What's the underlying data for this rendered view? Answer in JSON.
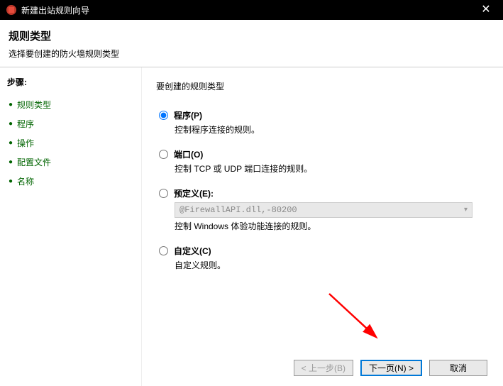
{
  "window": {
    "title": "新建出站规则向导"
  },
  "header": {
    "title": "规则类型",
    "subtitle": "选择要创建的防火墙规则类型"
  },
  "sidebar": {
    "steps_label": "步骤:",
    "items": [
      {
        "label": "规则类型"
      },
      {
        "label": "程序"
      },
      {
        "label": "操作"
      },
      {
        "label": "配置文件"
      },
      {
        "label": "名称"
      }
    ]
  },
  "main": {
    "prompt": "要创建的规则类型",
    "options": [
      {
        "label": "程序(P)",
        "desc": "控制程序连接的规则。",
        "checked": true
      },
      {
        "label": "端口(O)",
        "desc": "控制 TCP 或 UDP 端口连接的规则。",
        "checked": false
      },
      {
        "label": "预定义(E):",
        "desc": "控制 Windows 体验功能连接的规则。",
        "checked": false,
        "dropdown": "@FirewallAPI.dll,-80200"
      },
      {
        "label": "自定义(C)",
        "desc": "自定义规则。",
        "checked": false
      }
    ]
  },
  "footer": {
    "back": "< 上一步(B)",
    "next": "下一页(N) >",
    "cancel": "取消"
  }
}
